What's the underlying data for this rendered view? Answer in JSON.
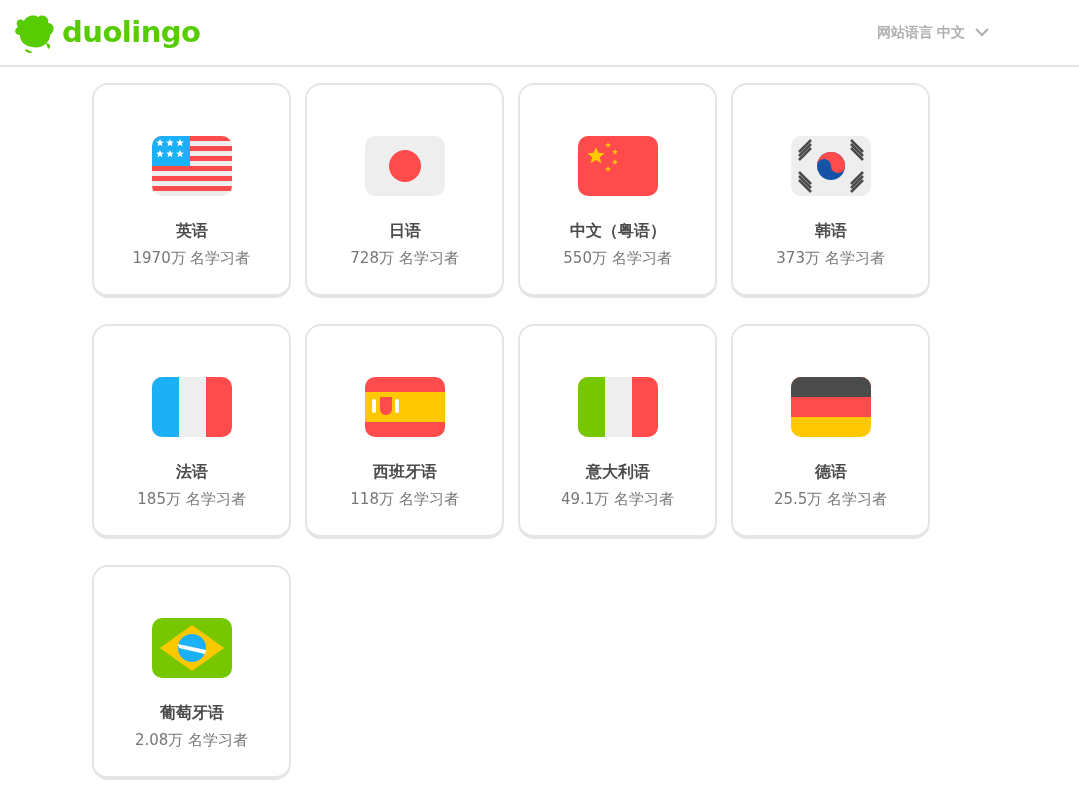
{
  "header": {
    "logo_text": "duolingo",
    "site_language_label": "网站语言",
    "site_language_value": "中文"
  },
  "courses": [
    {
      "kind": "us",
      "name": "英语",
      "learners": "1970万 名学习者"
    },
    {
      "kind": "jp",
      "name": "日语",
      "learners": "728万 名学习者"
    },
    {
      "kind": "cn",
      "name": "中文（粤语）",
      "learners": "550万 名学习者"
    },
    {
      "kind": "kr",
      "name": "韩语",
      "learners": "373万 名学习者"
    },
    {
      "kind": "fr",
      "name": "法语",
      "learners": "185万 名学习者"
    },
    {
      "kind": "es",
      "name": "西班牙语",
      "learners": "118万 名学习者"
    },
    {
      "kind": "it",
      "name": "意大利语",
      "learners": "49.1万 名学习者"
    },
    {
      "kind": "de",
      "name": "德语",
      "learners": "25.5万 名学习者"
    },
    {
      "kind": "br",
      "name": "葡萄牙语",
      "learners": "2.08万 名学习者"
    }
  ]
}
